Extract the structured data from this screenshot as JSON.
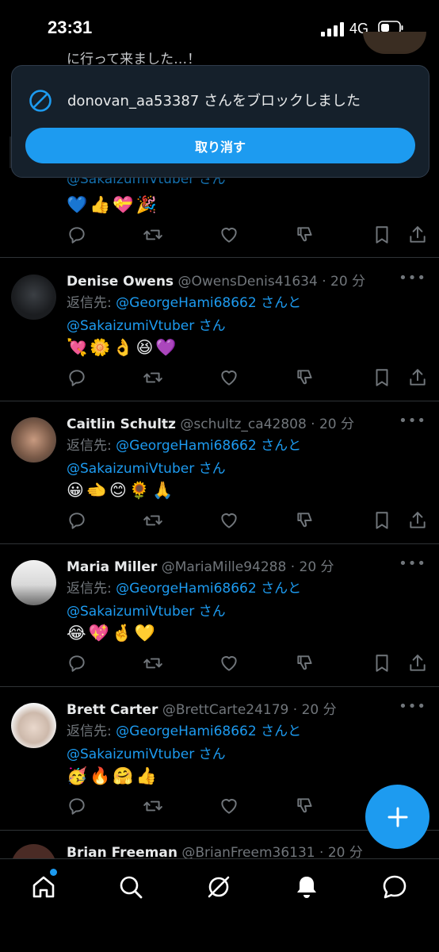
{
  "status_bar": {
    "time": "23:31",
    "network": "4G"
  },
  "peek_tweet": {
    "text": "に行って来ました…！"
  },
  "toast": {
    "message": "donovan_aa53387 さんをブロックしました",
    "undo_label": "取り消す"
  },
  "first_tweet": {
    "reply_to": "@SakaizumiVtuber さん",
    "emoji": "💙👍💝🎉"
  },
  "reply_prefix": "返信先:",
  "tweets": [
    {
      "name": "Denise Owens",
      "handle": "@OwensDenis41634 · 20 分",
      "reply_user1": "@GeorgeHami68662 さんと",
      "reply_user2": "@SakaizumiVtuber さん",
      "emoji": "💘🌼👌😆💜"
    },
    {
      "name": "Caitlin Schultz",
      "handle": "@schultz_ca42808 · 20 分",
      "reply_user1": "@GeorgeHami68662 さんと",
      "reply_user2": "@SakaizumiVtuber さん",
      "emoji": "😀🫲😊🌻🙏"
    },
    {
      "name": "Maria Miller",
      "handle": "@MariaMille94288 · 20 分",
      "reply_user1": "@GeorgeHami68662 さんと",
      "reply_user2": "@SakaizumiVtuber さん",
      "emoji": "😂💖🤞💛"
    },
    {
      "name": "Brett Carter",
      "handle": "@BrettCarte24179 · 20 分",
      "reply_user1": "@GeorgeHami68662 さんと",
      "reply_user2": "@SakaizumiVtuber さん",
      "emoji": "🥳🔥🤗👍"
    },
    {
      "name": "Brian Freeman",
      "handle": "@BrianFreem36131 · 20 分"
    }
  ],
  "icons": [
    "reply-icon",
    "retweet-icon",
    "like-icon",
    "dislike-icon",
    "bookmark-icon",
    "share-icon",
    "compose-icon",
    "home-icon",
    "search-icon",
    "communities-icon",
    "notifications-icon",
    "messages-icon",
    "block-icon"
  ],
  "colors": {
    "accent": "#1d9bf0",
    "background": "#000000",
    "toast_bg": "#15202b"
  }
}
